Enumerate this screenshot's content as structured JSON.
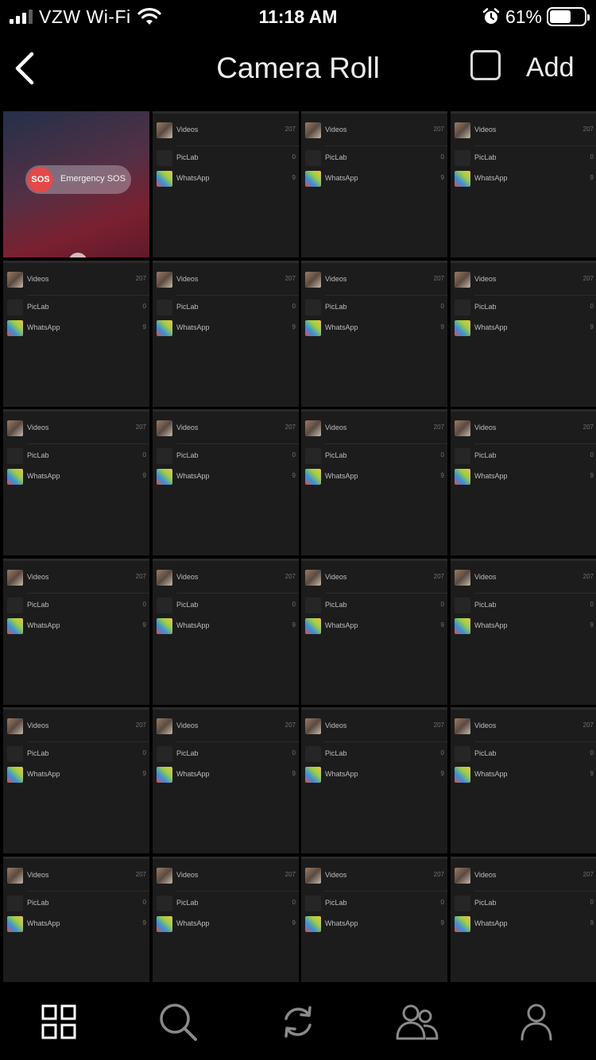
{
  "status_bar": {
    "carrier": "VZW Wi-Fi",
    "time": "11:18 AM",
    "battery_percent": "61%",
    "battery_level": 0.61,
    "icons": [
      "signal-icon",
      "wifi-icon",
      "alarm-icon",
      "battery-icon"
    ]
  },
  "nav": {
    "back_icon": "chevron-left-icon",
    "title": "Camera Roll",
    "select_icon": "checkbox-icon",
    "add_label": "Add"
  },
  "grid": {
    "columns": 4,
    "rows": 6,
    "first_tile": {
      "sos_badge": "SOS",
      "sos_label": "Emergency SOS"
    },
    "screenshot_rows": [
      {
        "label": "Videos",
        "count": "207",
        "thumb": "videos"
      },
      {
        "label": "PicLab",
        "count": "0",
        "thumb": "empty"
      },
      {
        "label": "WhatsApp",
        "count": "9",
        "thumb": "whatsapp"
      }
    ]
  },
  "tabbar": {
    "items": [
      {
        "name": "grid-icon",
        "active": true
      },
      {
        "name": "search-icon",
        "active": false
      },
      {
        "name": "sync-icon",
        "active": false
      },
      {
        "name": "people-icon",
        "active": false
      },
      {
        "name": "profile-icon",
        "active": false
      }
    ],
    "active_color": "#ffffff",
    "inactive_color": "#8a8a8a"
  }
}
